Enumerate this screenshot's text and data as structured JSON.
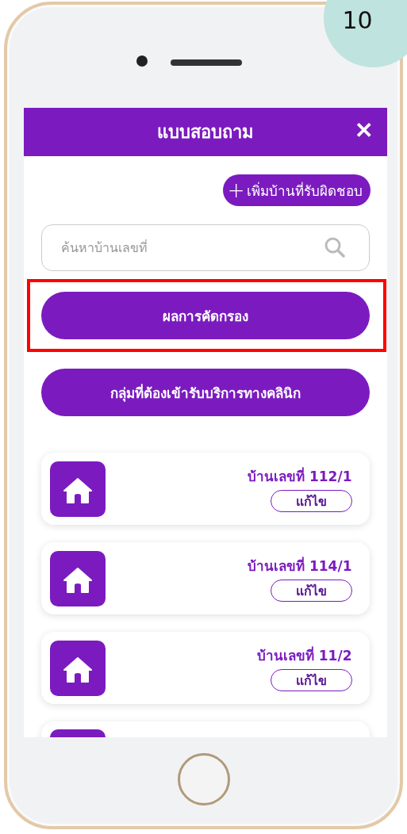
{
  "page_number": "10",
  "header": {
    "title": "แบบสอบถาม",
    "close": "✕"
  },
  "add_button": {
    "icon": "+",
    "label": "เพิ่มบ้านที่รับผิดชอบ"
  },
  "search": {
    "placeholder": "ค้นหาบ้านเลขที่"
  },
  "actions": [
    {
      "label": "ผลการคัดกรอง",
      "highlighted": true
    },
    {
      "label": "กลุ่มที่ต้องเข้ารับบริการทางคลินิก",
      "highlighted": false
    }
  ],
  "houses": [
    {
      "label": "บ้านเลขที่ 112/1",
      "edit": "แก้ไข"
    },
    {
      "label": "บ้านเลขที่ 114/1",
      "edit": "แก้ไข"
    },
    {
      "label": "บ้านเลขที่ 11/2",
      "edit": "แก้ไข"
    }
  ]
}
